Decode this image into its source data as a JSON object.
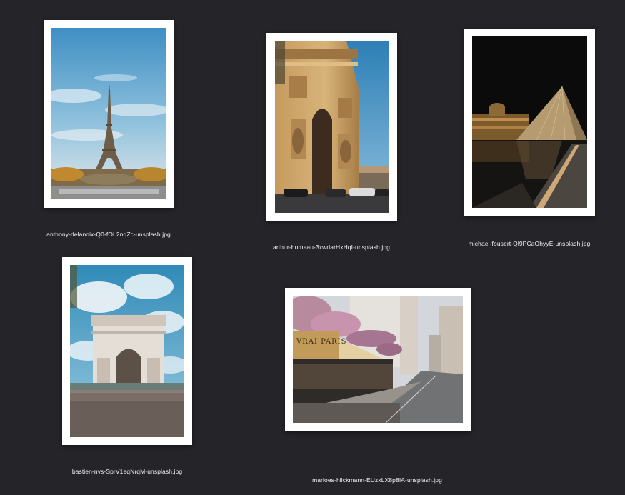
{
  "desktop": {
    "background_color": "#252429",
    "files": [
      {
        "name": "anthony-delanoix-Q0-fOL2nqZc-unsplash.jpg",
        "depicts": "eiffel-tower"
      },
      {
        "name": "arthur-humeau-3xwdarHxHqI-unsplash.jpg",
        "depicts": "arc-de-triomphe-closeup"
      },
      {
        "name": "michael-fousert-Ql9PCaOhyyE-unsplash.jpg",
        "depicts": "louvre-pyramid-night"
      },
      {
        "name": "bastien-nvs-SprV1eqNrqM-unsplash.jpg",
        "depicts": "arc-de-triomphe-sky"
      },
      {
        "name": "marloes-hilckmann-EUzxLX8p8IA-unsplash.jpg",
        "depicts": "paris-cafe-street"
      }
    ],
    "cafe_sign_text": "VRAI PARIS"
  }
}
